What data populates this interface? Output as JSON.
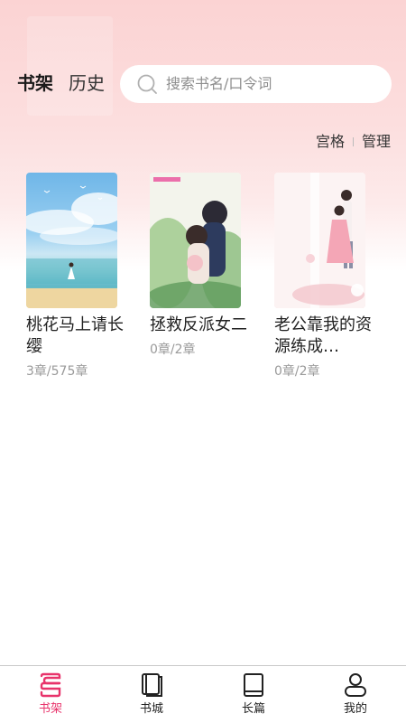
{
  "header": {
    "tabs": [
      {
        "label": "书架",
        "active": true
      },
      {
        "label": "历史",
        "active": false
      }
    ],
    "search": {
      "placeholder": "搜索书名/口令词"
    }
  },
  "shelf_actions": {
    "grid_label": "宫格",
    "manage_label": "管理"
  },
  "books": [
    {
      "title": "桃花马上请长缨",
      "progress": "3章/575章"
    },
    {
      "title": "拯救反派女二",
      "progress": "0章/2章"
    },
    {
      "title": "老公靠我的资源练成…",
      "progress": "0章/2章"
    }
  ],
  "tabbar": {
    "items": [
      {
        "label": "书架",
        "icon": "bookshelf-icon",
        "active": true
      },
      {
        "label": "书城",
        "icon": "book-store-icon",
        "active": false
      },
      {
        "label": "长篇",
        "icon": "book-icon",
        "active": false
      },
      {
        "label": "我的",
        "icon": "user-icon",
        "active": false
      }
    ]
  },
  "colors": {
    "accent": "#e8336b",
    "header_pink": "#fbd3d3"
  }
}
